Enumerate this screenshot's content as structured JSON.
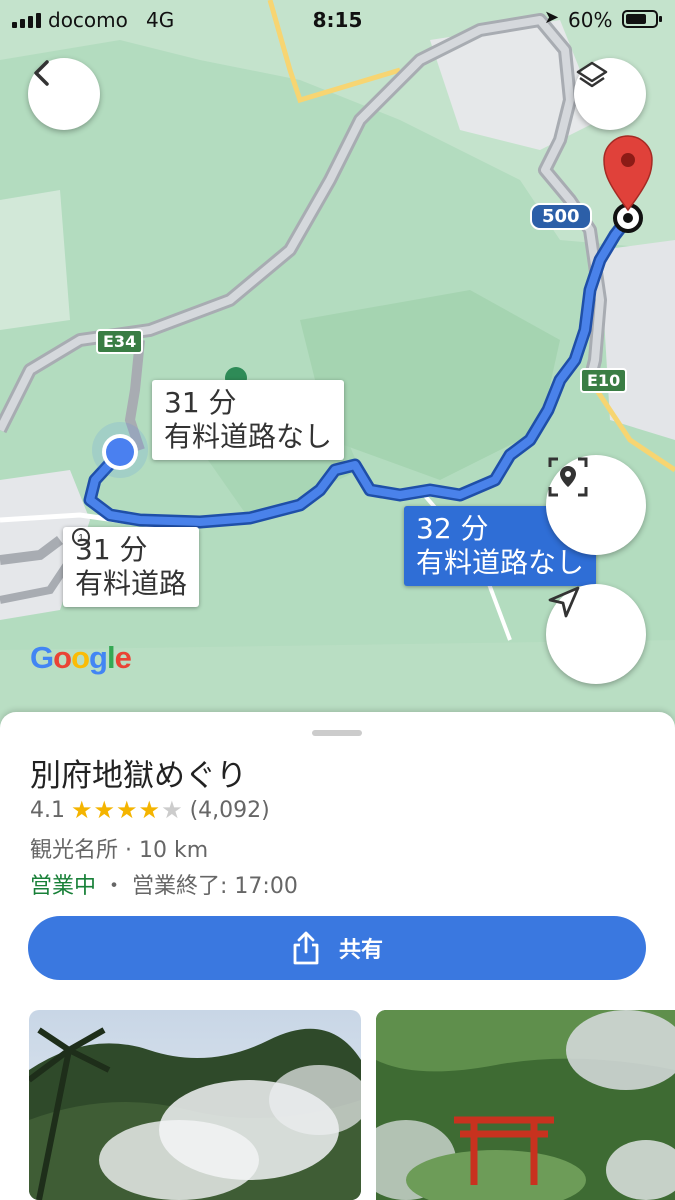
{
  "status_bar": {
    "carrier": "docomo",
    "network": "4G",
    "time": "8:15",
    "battery": "60%"
  },
  "map": {
    "routes": [
      {
        "time": "31 分",
        "desc": "有料道路なし",
        "selected": false
      },
      {
        "time": "31 分",
        "desc": "有料道路",
        "selected": false,
        "icon": "toll-icon"
      },
      {
        "time": "32 分",
        "desc": "有料道路なし",
        "selected": true
      }
    ],
    "road_shields": [
      "E34",
      "500",
      "E10"
    ],
    "google_logo": "Google",
    "colors": {
      "route_selected": "#3a6fd8",
      "route_alt": "#a9b8c8",
      "destination_pin": "#d93025",
      "park": "#b3dcbf"
    }
  },
  "controls": {
    "back": "back-arrow-icon",
    "layers": "layers-icon",
    "explore": "place-focus-icon",
    "recenter": "navigation-arrow-icon"
  },
  "place": {
    "name": "別府地獄めぐり",
    "rating": "4.1",
    "rating_value": 4.1,
    "reviews": "(4,092)",
    "category": "観光名所 · 10 km",
    "status_open": "営業中",
    "status_sep": "・",
    "closing": "営業終了: 17:00",
    "share_label": "共有"
  },
  "photos": [
    "steam-jungle-photo",
    "torii-garden-photo"
  ]
}
